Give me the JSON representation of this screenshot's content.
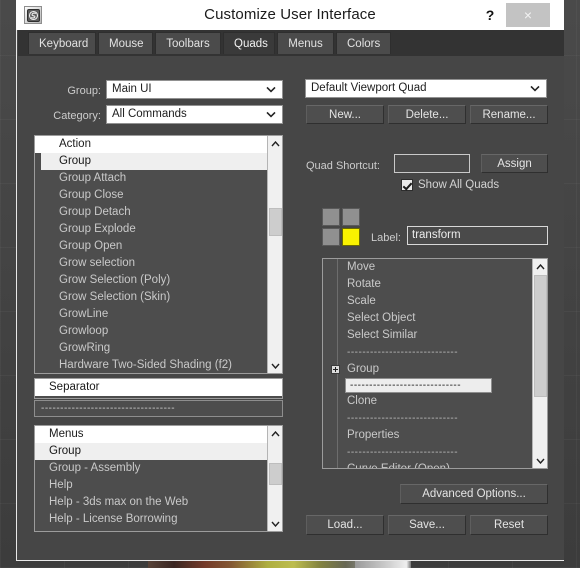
{
  "window": {
    "title": "Customize User Interface",
    "help_label": "?",
    "close_label": "×",
    "app_icon": "3dsmax-logo-icon"
  },
  "tabs": [
    {
      "label": "Keyboard",
      "active": false
    },
    {
      "label": "Mouse",
      "active": false
    },
    {
      "label": "Toolbars",
      "active": false
    },
    {
      "label": "Quads",
      "active": true
    },
    {
      "label": "Menus",
      "active": false
    },
    {
      "label": "Colors",
      "active": false
    }
  ],
  "left": {
    "group_label": "Group:",
    "group_value": "Main UI",
    "category_label": "Category:",
    "category_value": "All Commands",
    "commands_header": "Action",
    "commands": [
      {
        "label": "Group",
        "selected": true
      },
      {
        "label": "Group Attach",
        "selected": false
      },
      {
        "label": "Group Close",
        "selected": false
      },
      {
        "label": "Group Detach",
        "selected": false
      },
      {
        "label": "Group Explode",
        "selected": false
      },
      {
        "label": "Group Open",
        "selected": false
      },
      {
        "label": "Grow selection",
        "selected": false
      },
      {
        "label": "Grow Selection (Poly)",
        "selected": false
      },
      {
        "label": "Grow Selection (Skin)",
        "selected": false
      },
      {
        "label": "GrowLine",
        "selected": false
      },
      {
        "label": "Growloop",
        "selected": false
      },
      {
        "label": "GrowRing",
        "selected": false
      },
      {
        "label": "Hardware Two-Sided Shading (f2)",
        "selected": false
      }
    ],
    "separator_header": "Separator",
    "separator_value": "-----------------------------------",
    "menus_header": "Menus",
    "menus": [
      {
        "label": "Group",
        "selected": true
      },
      {
        "label": "Group - Assembly",
        "selected": false
      },
      {
        "label": "Help",
        "selected": false
      },
      {
        "label": "Help - 3ds max on the Web",
        "selected": false
      },
      {
        "label": "Help - License Borrowing",
        "selected": false
      }
    ]
  },
  "right": {
    "quadset_value": "Default Viewport Quad",
    "new_label": "New...",
    "delete_label": "Delete...",
    "rename_label": "Rename...",
    "quad_shortcut_label": "Quad Shortcut:",
    "quad_shortcut_value": "",
    "assign_label": "Assign",
    "show_all_quads_label": "Show All Quads",
    "show_all_quads_checked": true,
    "quad_cells": [
      {
        "name": "top-left",
        "active": false
      },
      {
        "name": "top-right",
        "active": false
      },
      {
        "name": "bottom-left",
        "active": false
      },
      {
        "name": "bottom-right",
        "active": true
      }
    ],
    "label_label": "Label:",
    "label_value": "transform",
    "menu_items": [
      {
        "label": "Move",
        "type": "item",
        "selected": false,
        "expandable": false
      },
      {
        "label": "Rotate",
        "type": "item",
        "selected": false,
        "expandable": false
      },
      {
        "label": "Scale",
        "type": "item",
        "selected": false,
        "expandable": false
      },
      {
        "label": "Select Object",
        "type": "item",
        "selected": false,
        "expandable": false
      },
      {
        "label": "Select Similar",
        "type": "item",
        "selected": false,
        "expandable": false
      },
      {
        "label": "-----------------------------",
        "type": "separator",
        "selected": false,
        "expandable": false
      },
      {
        "label": "Group",
        "type": "item",
        "selected": false,
        "expandable": true
      },
      {
        "label": "-----------------------------",
        "type": "separator",
        "selected": true,
        "expandable": false
      },
      {
        "label": "Clone",
        "type": "item",
        "selected": false,
        "expandable": false
      },
      {
        "label": "-----------------------------",
        "type": "separator",
        "selected": false,
        "expandable": false
      },
      {
        "label": "Properties",
        "type": "item",
        "selected": false,
        "expandable": false
      },
      {
        "label": "-----------------------------",
        "type": "separator",
        "selected": false,
        "expandable": false
      },
      {
        "label": "Curve Editor (Open)",
        "type": "item",
        "selected": false,
        "expandable": false
      }
    ],
    "advanced_options_label": "Advanced Options...",
    "load_label": "Load...",
    "save_label": "Save...",
    "reset_label": "Reset"
  },
  "colors": {
    "dialog_bg": "#464646",
    "titlebar_bg": "#ffffff",
    "tab_bg": "#4b4b4b",
    "tab_active_bg": "#3a3a3a",
    "list_bg": "#4d4d4d",
    "list_header_bg": "#ffffff",
    "selection_bg": "#efefef",
    "quad_active": "#f9f200",
    "text": "#cccccc"
  }
}
